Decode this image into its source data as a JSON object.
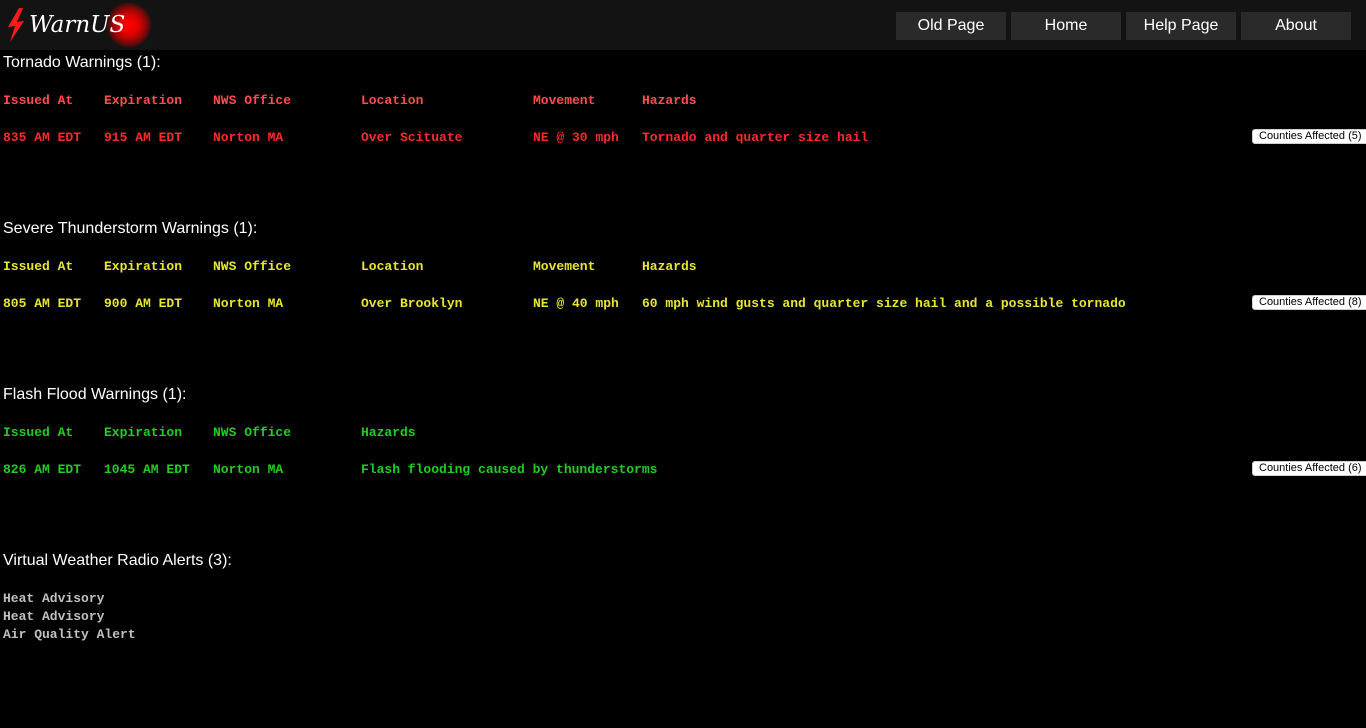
{
  "header": {
    "logo_text": "WarnUS",
    "nav": [
      "Old Page",
      "Home",
      "Help Page",
      "About"
    ]
  },
  "tornado": {
    "title": "Tornado Warnings (1):",
    "headers": [
      "Issued At",
      "Expiration",
      "NWS Office",
      "Location",
      "Movement",
      "Hazards"
    ],
    "rows": [
      {
        "issued": "835 AM EDT",
        "expiration": "915 AM EDT",
        "office": "Norton MA",
        "location": "Over Scituate",
        "movement": "NE @ 30 mph",
        "hazards": "Tornado and quarter size hail",
        "counties": "Counties Affected (5)"
      }
    ]
  },
  "severe": {
    "title": "Severe Thunderstorm Warnings (1):",
    "headers": [
      "Issued At",
      "Expiration",
      "NWS Office",
      "Location",
      "Movement",
      "Hazards"
    ],
    "rows": [
      {
        "issued": "805 AM EDT",
        "expiration": "900 AM EDT",
        "office": "Norton MA",
        "location": "Over Brooklyn",
        "movement": "NE @ 40 mph",
        "hazards": "60 mph wind gusts and quarter size hail and a possible tornado",
        "counties": "Counties Affected (8)"
      }
    ]
  },
  "flood": {
    "title": "Flash Flood Warnings (1):",
    "headers": [
      "Issued At",
      "Expiration",
      "NWS Office",
      "Hazards"
    ],
    "rows": [
      {
        "issued": "826 AM EDT",
        "expiration": "1045 AM EDT",
        "office": "Norton MA",
        "hazards": "Flash flooding caused by thunderstorms",
        "counties": "Counties Affected (6)"
      }
    ]
  },
  "radio": {
    "title": "Virtual Weather Radio Alerts (3):",
    "alerts": [
      "Heat Advisory",
      "Heat Advisory",
      "Air Quality Alert"
    ]
  },
  "colors": {
    "background": "#000000",
    "topbar": "#131313",
    "tornado": "#ff2a2a",
    "severe": "#e6e630",
    "flood": "#22cc22",
    "radio": "#c0c0c0"
  }
}
